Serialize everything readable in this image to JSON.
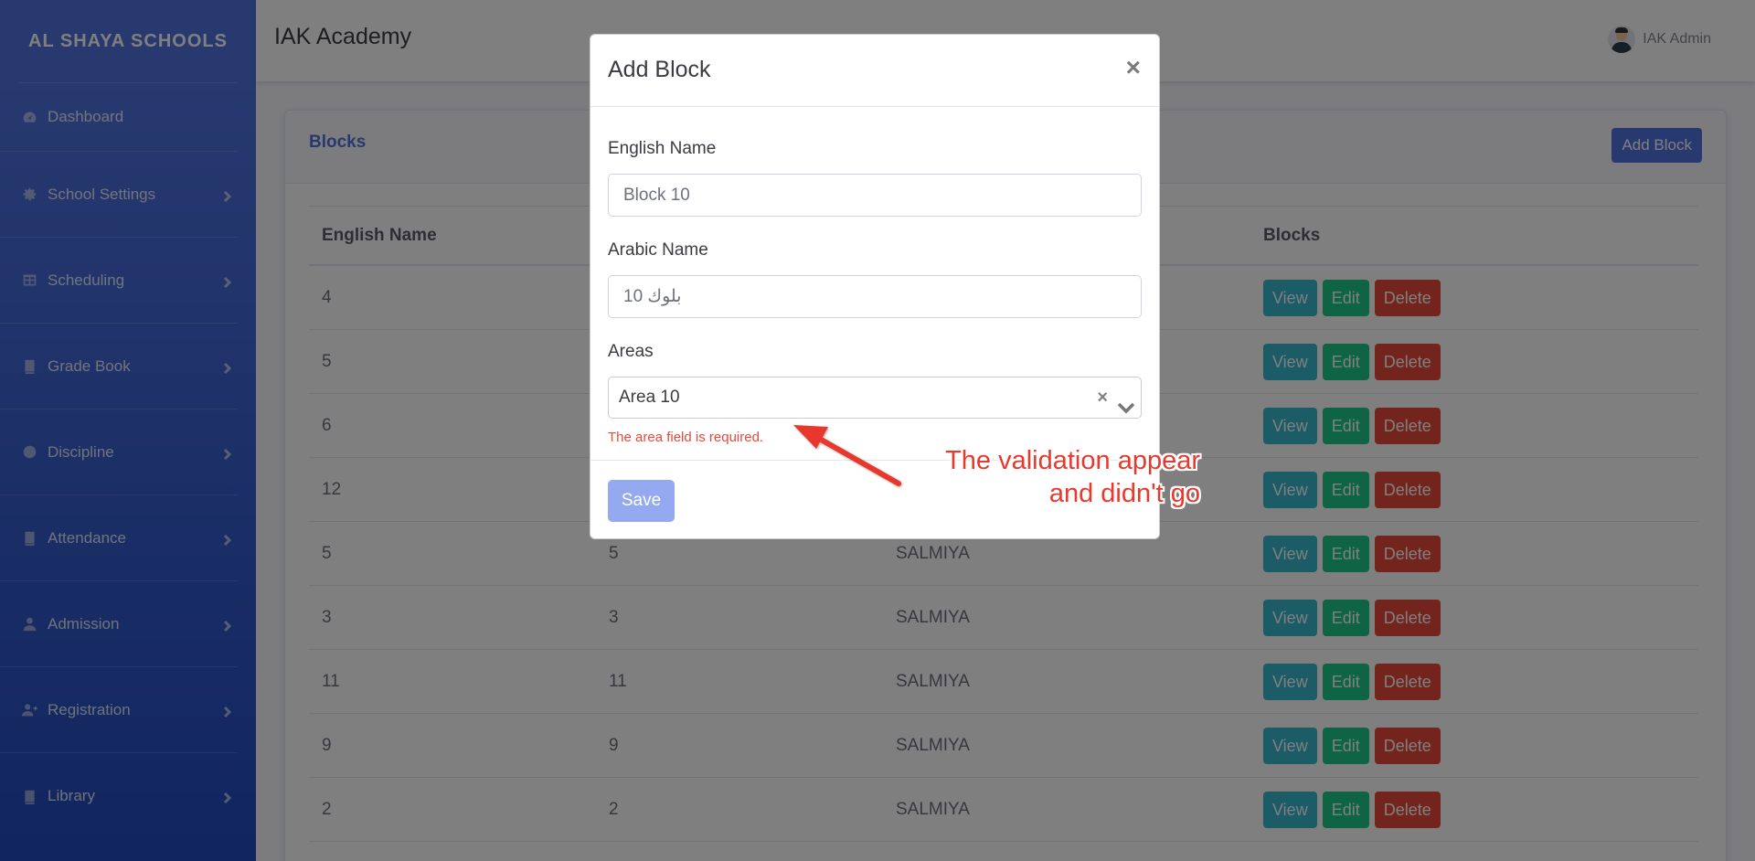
{
  "sidebar": {
    "brand": "AL SHAYA SCHOOLS",
    "items": [
      {
        "label": "Dashboard",
        "icon": "dashboard-icon"
      },
      {
        "label": "School Settings",
        "icon": "gear-icon"
      },
      {
        "label": "Scheduling",
        "icon": "table-icon"
      },
      {
        "label": "Grade Book",
        "icon": "book-icon"
      },
      {
        "label": "Discipline",
        "icon": "smile-icon"
      },
      {
        "label": "Attendance",
        "icon": "book-icon"
      },
      {
        "label": "Admission",
        "icon": "user-icon"
      },
      {
        "label": "Registration",
        "icon": "user-plus-icon"
      },
      {
        "label": "Library",
        "icon": "book-icon"
      }
    ]
  },
  "header": {
    "title": "IAK Academy",
    "user_name": "IAK Admin"
  },
  "card": {
    "title": "Blocks",
    "add_button": "Add Block",
    "columns": [
      "English Name",
      "",
      "",
      "Blocks"
    ],
    "rows": [
      {
        "english": "4",
        "arabic": "",
        "area": ""
      },
      {
        "english": "5",
        "arabic": "",
        "area": ""
      },
      {
        "english": "6",
        "arabic": "",
        "area": ""
      },
      {
        "english": "12",
        "arabic": "",
        "area": ""
      },
      {
        "english": "5",
        "arabic": "5",
        "area": "SALMIYA"
      },
      {
        "english": "3",
        "arabic": "3",
        "area": "SALMIYA"
      },
      {
        "english": "11",
        "arabic": "11",
        "area": "SALMIYA"
      },
      {
        "english": "9",
        "arabic": "9",
        "area": "SALMIYA"
      },
      {
        "english": "2",
        "arabic": "2",
        "area": "SALMIYA"
      }
    ],
    "actions": {
      "view": "View",
      "edit": "Edit",
      "delete": "Delete"
    }
  },
  "modal": {
    "title": "Add Block",
    "close": "×",
    "english_label": "English Name",
    "english_value": "Block 10",
    "arabic_label": "Arabic Name",
    "arabic_value": "بلوك 10",
    "areas_label": "Areas",
    "areas_value": "Area 10",
    "areas_clear": "×",
    "error": "The area field is required.",
    "save": "Save"
  },
  "annotation": {
    "line1": "The validation appear",
    "line2": "and didn't go",
    "color": "#e8392e"
  }
}
